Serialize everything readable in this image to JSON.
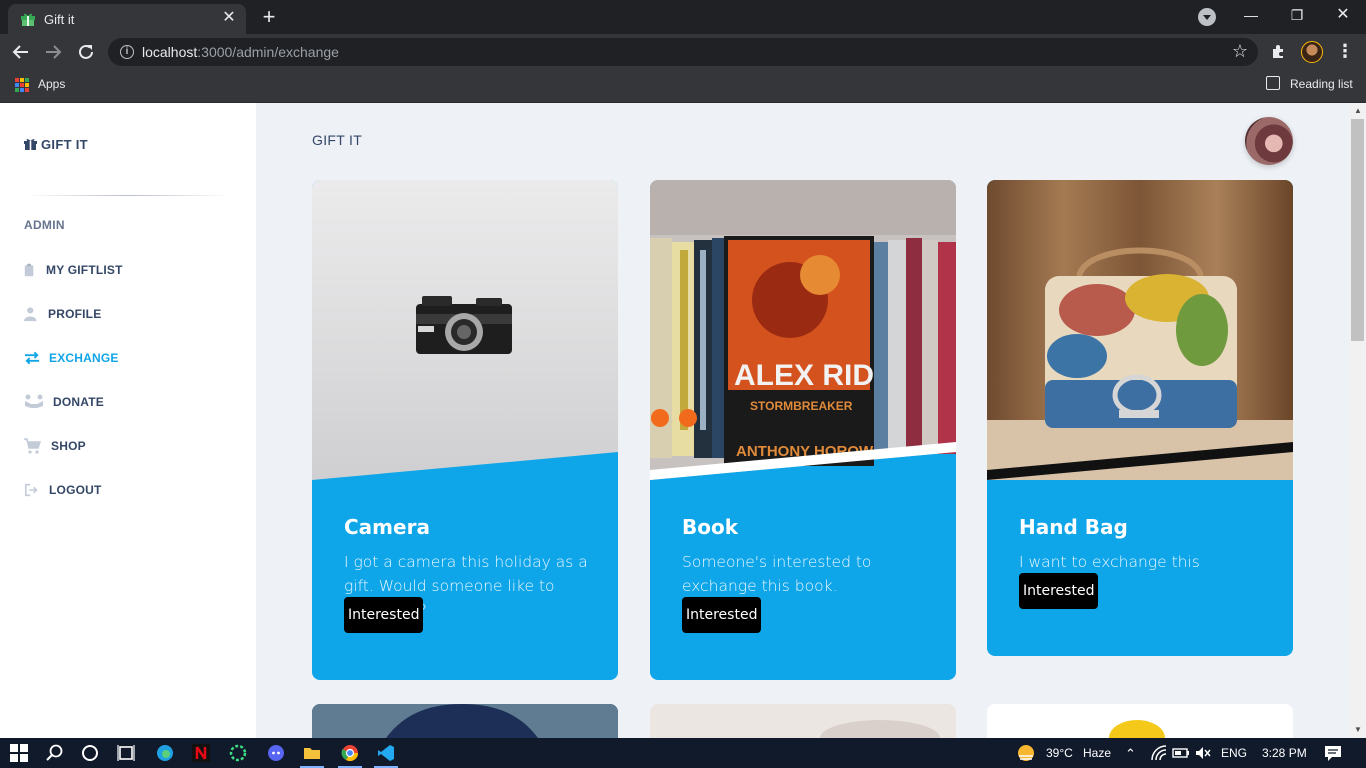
{
  "browser": {
    "tab_title": "Gift it",
    "url_host": "localhost",
    "url_path": ":3000/admin/exchange",
    "bookmarks": {
      "apps": "Apps",
      "reading_list": "Reading list"
    }
  },
  "sidebar": {
    "brand": "GIFT IT",
    "section": "ADMIN",
    "items": [
      {
        "label": "MY GIFTLIST",
        "icon": "clipboard-icon"
      },
      {
        "label": "PROFILE",
        "icon": "user-icon"
      },
      {
        "label": "EXCHANGE",
        "icon": "exchange-icon",
        "active": true
      },
      {
        "label": "DONATE",
        "icon": "donate-icon"
      },
      {
        "label": "SHOP",
        "icon": "cart-icon"
      },
      {
        "label": "LOGOUT",
        "icon": "logout-icon"
      }
    ]
  },
  "main": {
    "title": "GIFT IT",
    "cards": [
      {
        "title": "Camera",
        "description": "I got a camera this holiday as a gift. Would someone like to exchange?",
        "button": "Interested"
      },
      {
        "title": "Book",
        "description": "Someone's interested to exchange this book.",
        "button": "Interested"
      },
      {
        "title": "Hand Bag",
        "description": "I want to exchange this handbag.",
        "button": "Interested"
      }
    ]
  },
  "taskbar": {
    "temperature": "39°C",
    "weather": "Haze",
    "language": "ENG",
    "time": "3:28 PM"
  },
  "colors": {
    "accent": "#0ea5e9",
    "sidebar_text": "#344767",
    "active": "#11a5e8"
  }
}
